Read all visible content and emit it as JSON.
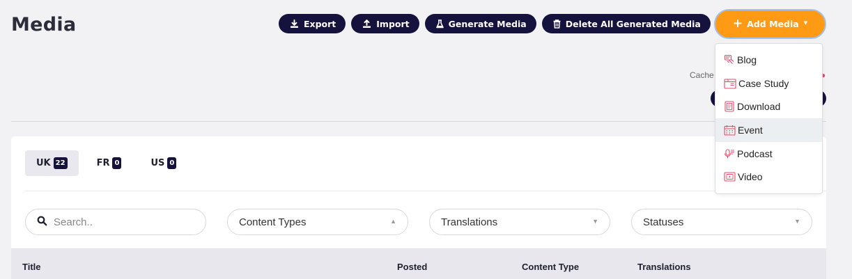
{
  "header": {
    "title": "Media"
  },
  "toolbar": {
    "export_label": "Export",
    "import_label": "Import",
    "generate_label": "Generate Media",
    "delete_label": "Delete All Generated Media",
    "add_label": "Add Media"
  },
  "add_menu": {
    "items": [
      {
        "label": "Blog",
        "icon": "blog-icon"
      },
      {
        "label": "Case Study",
        "icon": "case-study-icon"
      },
      {
        "label": "Download",
        "icon": "download-doc-icon"
      },
      {
        "label": "Event",
        "icon": "calendar-icon"
      },
      {
        "label": "Podcast",
        "icon": "podcast-icon"
      },
      {
        "label": "Video",
        "icon": "video-icon"
      }
    ],
    "hovered": "Event"
  },
  "cache": {
    "label": "Cache"
  },
  "tabs": [
    {
      "label": "UK",
      "count": "22",
      "active": true
    },
    {
      "label": "FR",
      "count": "0",
      "active": false
    },
    {
      "label": "US",
      "count": "0",
      "active": false
    }
  ],
  "filters": {
    "search_placeholder": "Search..",
    "content_types": "Content Types",
    "translations": "Translations",
    "statuses": "Statuses"
  },
  "table": {
    "columns": [
      "Title",
      "Posted",
      "Content Type",
      "Translations"
    ]
  },
  "colors": {
    "primary": "#15123d",
    "accent": "#ff9a14",
    "menu_icon": "#e84a6a",
    "background": "#f2f2f5"
  }
}
